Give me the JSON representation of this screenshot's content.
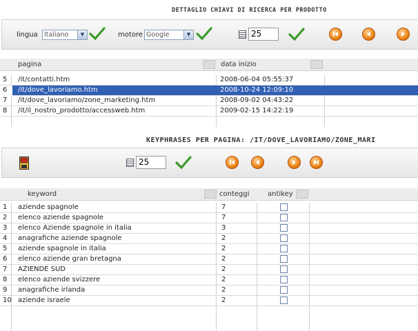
{
  "top": {
    "title": "DETTAGLIO CHIAVI DI RICERCA PER PRODOTTO",
    "lingua_label": "lingua",
    "lingua_value": "Italiano",
    "motore_label": "motore",
    "motore_value": "Google",
    "page_size": "25",
    "columns": [
      "pagina",
      "data inizio"
    ],
    "rows": [
      {
        "num": "5",
        "pagina": "/it/contatti.htm",
        "data": "2008-06-04 05:55:37",
        "selected": false
      },
      {
        "num": "6",
        "pagina": "/it/dove_lavoriamo.htm",
        "data": "2008-10-24 12:09:10",
        "selected": true
      },
      {
        "num": "7",
        "pagina": "/it/dove_lavoriamo/zone_marketing.htm",
        "data": "2008-09-02 04:43:22",
        "selected": false
      },
      {
        "num": "8",
        "pagina": "/it/il_nostro_prodotto/accessweb.htm",
        "data": "2009-02-15 14:22:19",
        "selected": false
      }
    ]
  },
  "bottom": {
    "title": "KEYPHRASES PER PAGINA: /IT/DOVE_LAVORIAMO/ZONE_MARI",
    "page_size": "25",
    "columns": [
      "keyword",
      "conteggi",
      "antikey"
    ],
    "rows": [
      {
        "num": "1",
        "keyword": "aziende spagnole",
        "count": "7"
      },
      {
        "num": "2",
        "keyword": "elenco aziende spagnole",
        "count": "7"
      },
      {
        "num": "3",
        "keyword": "elenco Aziende spagnole in italia",
        "count": "3"
      },
      {
        "num": "4",
        "keyword": "anagrafiche aziende spagnole",
        "count": "2"
      },
      {
        "num": "5",
        "keyword": "aziende spagnole in italia",
        "count": "2"
      },
      {
        "num": "6",
        "keyword": "elenco aziende gran bretagna",
        "count": "2"
      },
      {
        "num": "7",
        "keyword": "AZIENDE SUD",
        "count": "2"
      },
      {
        "num": "8",
        "keyword": "elenco aziende svizzere",
        "count": "2"
      },
      {
        "num": "9",
        "keyword": "anagrafiche irlanda",
        "count": "2"
      },
      {
        "num": "10",
        "keyword": "aziende israele",
        "count": "2"
      }
    ]
  },
  "colors": {
    "selected_row": "#3160b3",
    "check_green": "#3a9a2a",
    "nav_orange": "#f08a1e"
  },
  "icons": [
    "dropdown-arrow-icon",
    "green-check-icon",
    "grid-icon",
    "first-page-icon",
    "prev-page-icon",
    "next-page-icon",
    "last-page-icon",
    "save-icon"
  ]
}
